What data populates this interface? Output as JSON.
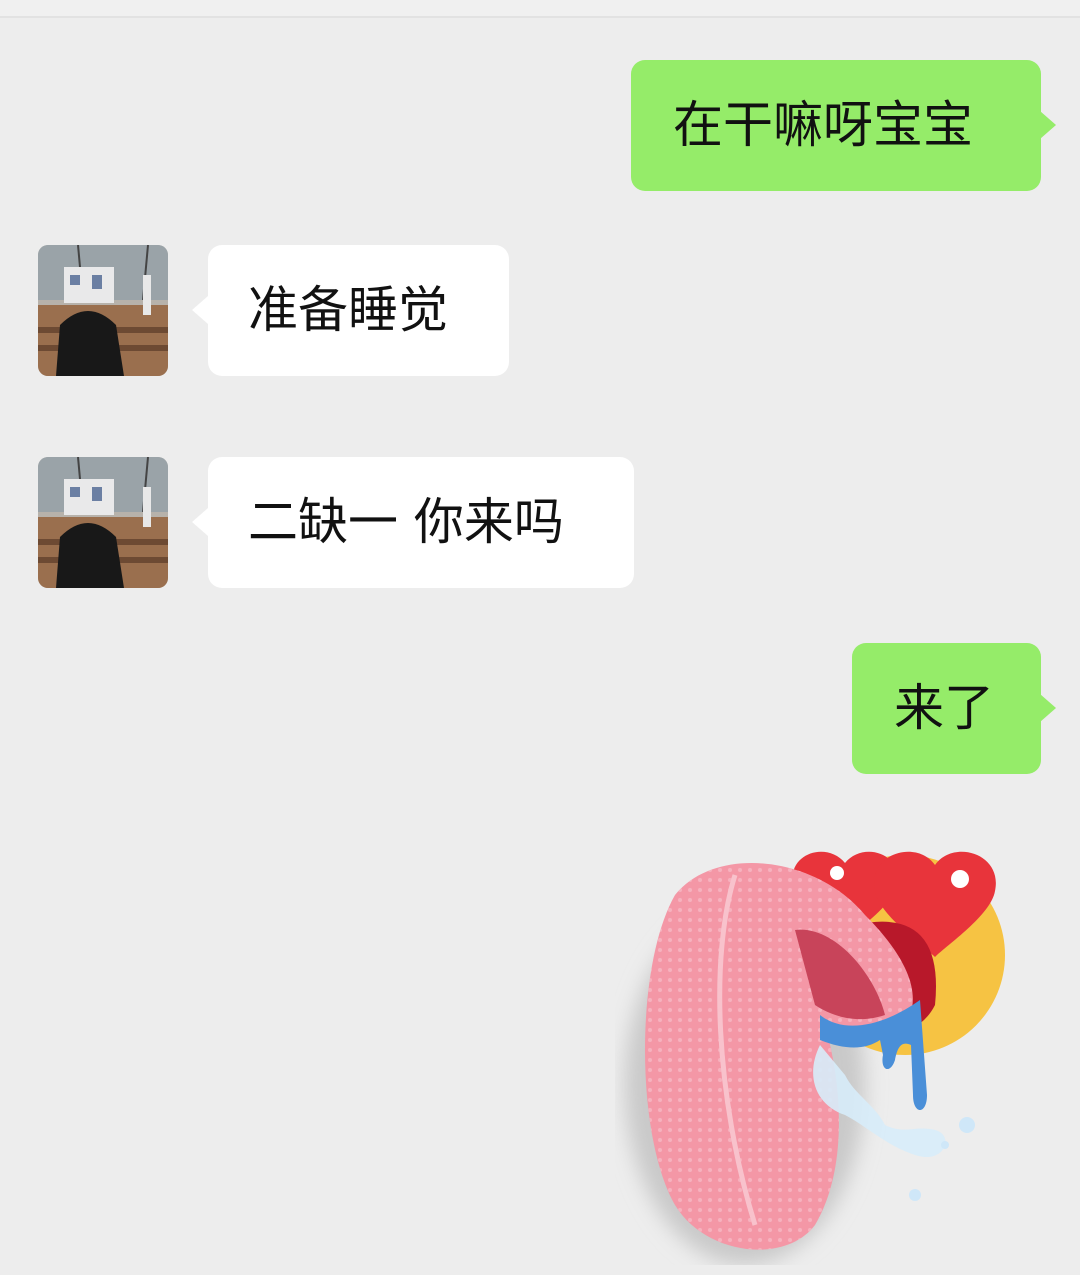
{
  "messages": [
    {
      "side": "out",
      "text": "在干嘛呀宝宝"
    },
    {
      "side": "in",
      "text": "准备睡觉"
    },
    {
      "side": "in",
      "text": "二缺一 你来吗"
    },
    {
      "side": "out",
      "text": "来了"
    }
  ],
  "sticker": {
    "icon": "drooling-love-emoji-icon"
  },
  "avatar": {
    "icon": "contact-avatar-photo"
  },
  "colors": {
    "background": "#ededed",
    "outgoing_bubble": "#95ec69",
    "incoming_bubble": "#ffffff"
  }
}
